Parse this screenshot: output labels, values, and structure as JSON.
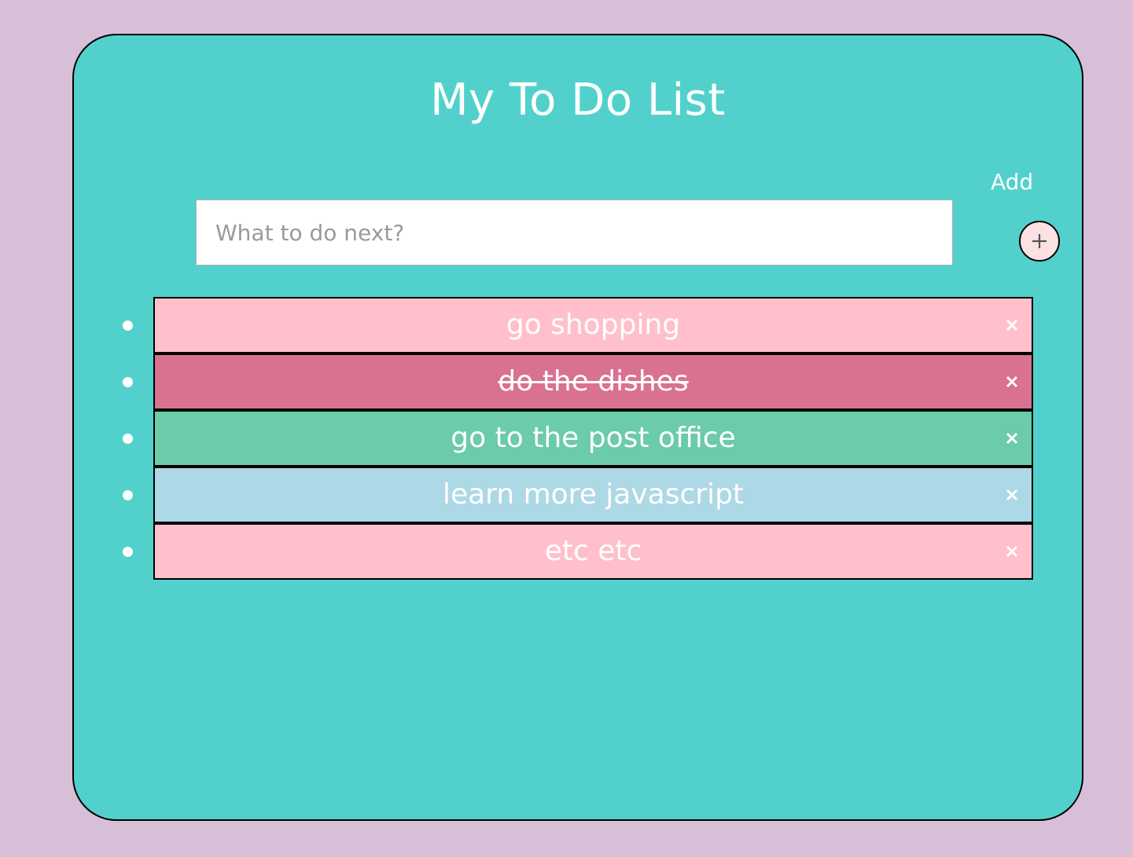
{
  "app": {
    "title": "My To Do List"
  },
  "input": {
    "placeholder": "What to do next?",
    "value": ""
  },
  "add": {
    "label": "Add",
    "button_icon": "plus-icon"
  },
  "todos": [
    {
      "text": "go shopping",
      "done": false,
      "color": "#ffc0cb"
    },
    {
      "text": "do the dishes",
      "done": true,
      "color": "#d97191"
    },
    {
      "text": "go to the post office",
      "done": false,
      "color": "#6ccba8"
    },
    {
      "text": "learn more javascript",
      "done": false,
      "color": "#add8e6"
    },
    {
      "text": "etc etc",
      "done": false,
      "color": "#ffc0cb"
    }
  ],
  "colors": {
    "page_background": "#d8bfd8",
    "card_background": "#52d1cc",
    "add_button_background": "#fbe1e1"
  },
  "icons": {
    "delete": "close-icon",
    "bullet": "bullet-dot"
  }
}
